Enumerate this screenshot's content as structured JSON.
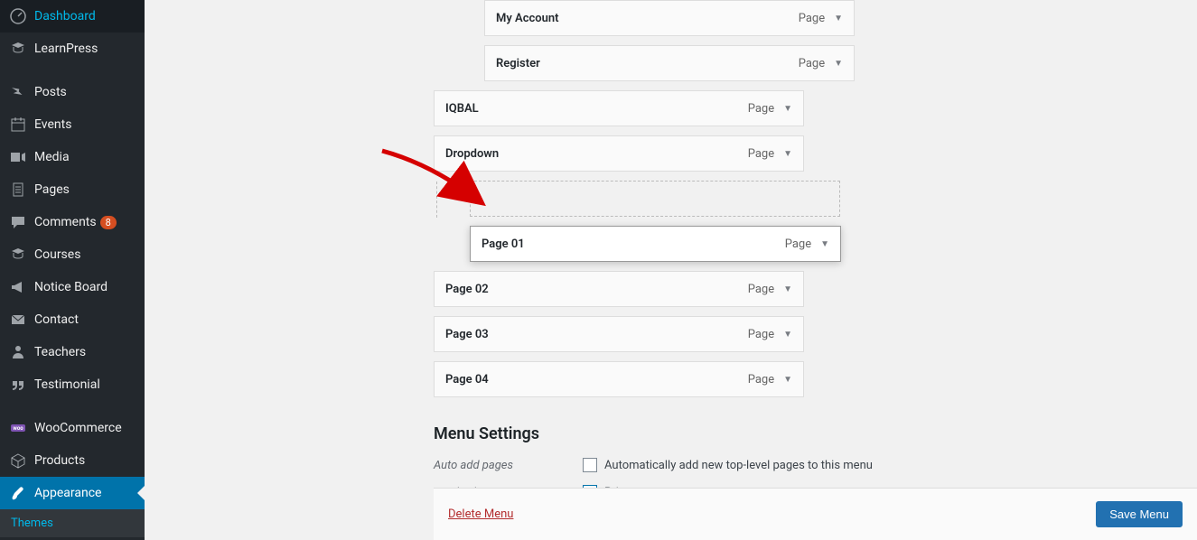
{
  "sidebar": {
    "items": [
      {
        "label": "Dashboard",
        "icon": "dashboard"
      },
      {
        "label": "LearnPress",
        "icon": "learnpress"
      },
      {
        "label": "Posts",
        "icon": "pin"
      },
      {
        "label": "Events",
        "icon": "calendar"
      },
      {
        "label": "Media",
        "icon": "media"
      },
      {
        "label": "Pages",
        "icon": "pages"
      },
      {
        "label": "Comments",
        "icon": "comment",
        "badge": "8"
      },
      {
        "label": "Courses",
        "icon": "learnpress"
      },
      {
        "label": "Notice Board",
        "icon": "megaphone"
      },
      {
        "label": "Contact",
        "icon": "mail"
      },
      {
        "label": "Teachers",
        "icon": "teacher"
      },
      {
        "label": "Testimonial",
        "icon": "quote"
      },
      {
        "label": "WooCommerce",
        "icon": "woo"
      },
      {
        "label": "Products",
        "icon": "product"
      },
      {
        "label": "Appearance",
        "icon": "brush",
        "active": true
      }
    ],
    "sub_item": "Themes"
  },
  "menu_items": [
    {
      "title": "My Account",
      "type": "Page",
      "indent": 1
    },
    {
      "title": "Register",
      "type": "Page",
      "indent": 1
    },
    {
      "title": "IQBAL",
      "type": "Page",
      "indent": 0
    },
    {
      "title": "Dropdown",
      "type": "Page",
      "indent": 0
    },
    {
      "title": "Page 01",
      "type": "Page",
      "indent": 0,
      "dragging": true,
      "placeholder_before": true
    },
    {
      "title": "Page 02",
      "type": "Page",
      "indent": 0
    },
    {
      "title": "Page 03",
      "type": "Page",
      "indent": 0
    },
    {
      "title": "Page 04",
      "type": "Page",
      "indent": 0
    }
  ],
  "settings": {
    "heading": "Menu Settings",
    "auto_add_label": "Auto add pages",
    "auto_add_text": "Automatically add new top-level pages to this menu",
    "auto_add_checked": false,
    "display_location_label": "Display location",
    "display_location_text": "Primary",
    "display_location_checked": true
  },
  "footer": {
    "delete_label": "Delete Menu",
    "save_label": "Save Menu"
  },
  "annotation": {
    "arrow_color": "#d50000"
  }
}
